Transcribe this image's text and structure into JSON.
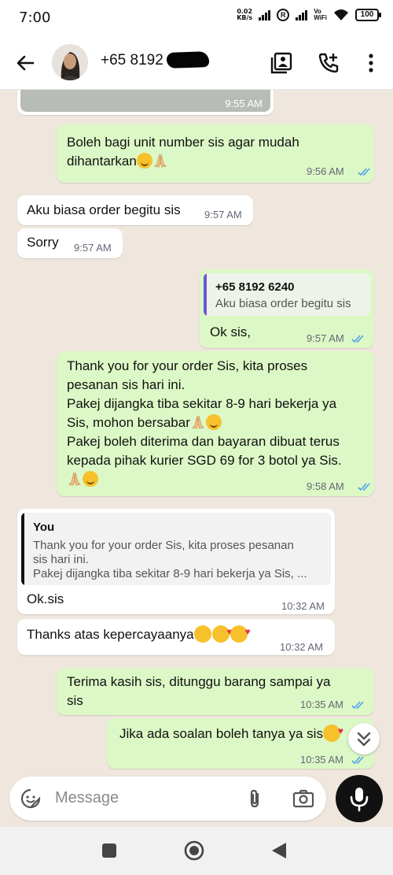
{
  "status_bar": {
    "time": "7:00",
    "net_speed_value": "0.02",
    "net_speed_unit": "KB/s",
    "vowifi_top": "Vo",
    "vowifi_bottom": "WiFi",
    "battery": "100"
  },
  "header": {
    "contact_name": "+65 8192",
    "icons": [
      "back-arrow-icon",
      "media-icon",
      "add-call-icon",
      "more-vert-icon"
    ]
  },
  "messages": [
    {
      "id": "m0",
      "direction": "out",
      "type": "image-preview",
      "time": "9:55 AM"
    },
    {
      "id": "m1",
      "direction": "out",
      "lines": [
        "Boleh bagi unit number sis agar mudah",
        "dihantarkan"
      ],
      "time": "9:56 AM",
      "status": "read"
    },
    {
      "id": "m2",
      "direction": "in",
      "lines": [
        "Aku biasa order begitu sis"
      ],
      "time": "9:57 AM"
    },
    {
      "id": "m3",
      "direction": "in",
      "lines": [
        "Sorry"
      ],
      "time": "9:57 AM"
    },
    {
      "id": "m4",
      "direction": "out",
      "reply_to": {
        "author": "+65 8192 6240",
        "text": "Aku biasa order begitu sis"
      },
      "lines": [
        "Ok sis,"
      ],
      "time": "9:57 AM",
      "status": "read"
    },
    {
      "id": "m5",
      "direction": "out",
      "lines": [
        "Thank you for your order Sis, kita proses",
        "pesanan sis hari ini.",
        "Pakej dijangka tiba sekitar 8-9 hari bekerja ya",
        "Sis, mohon bersabar",
        "Pakej boleh diterima dan bayaran dibuat terus",
        "kepada pihak kurier SGD 69 for 3 botol ya Sis."
      ],
      "time": "9:58 AM",
      "status": "read"
    },
    {
      "id": "m6",
      "direction": "in",
      "reply_to": {
        "author": "You",
        "lines": [
          "Thank you for your order Sis, kita proses pesanan",
          "sis hari ini.",
          "Pakej dijangka tiba sekitar 8-9 hari bekerja ya Sis, ..."
        ]
      },
      "lines": [
        "Ok.sis"
      ],
      "time": "10:32 AM"
    },
    {
      "id": "m7",
      "direction": "in",
      "lines": [
        "Thanks atas kepercayaanya"
      ],
      "time": "10:32 AM"
    },
    {
      "id": "m8",
      "direction": "out",
      "lines": [
        "Terima kasih sis, ditunggu barang sampai ya",
        "sis"
      ],
      "time": "10:35 AM",
      "status": "read"
    },
    {
      "id": "m9",
      "direction": "out",
      "lines": [
        "Jika ada soalan boleh tanya ya sis"
      ],
      "time": "10:35 AM",
      "status": "read"
    }
  ],
  "composer": {
    "placeholder": "Message",
    "icons": [
      "emoji-icon",
      "attach-icon",
      "camera-icon",
      "mic-icon"
    ]
  },
  "colors": {
    "outgoing_bubble": "#dcf8c6",
    "incoming_bubble": "#ffffff",
    "chat_background": "#efe7dd",
    "read_ticks": "#4fa4e8",
    "reply_bar_contact": "#6a55d6",
    "reply_bar_you": "#111111"
  }
}
